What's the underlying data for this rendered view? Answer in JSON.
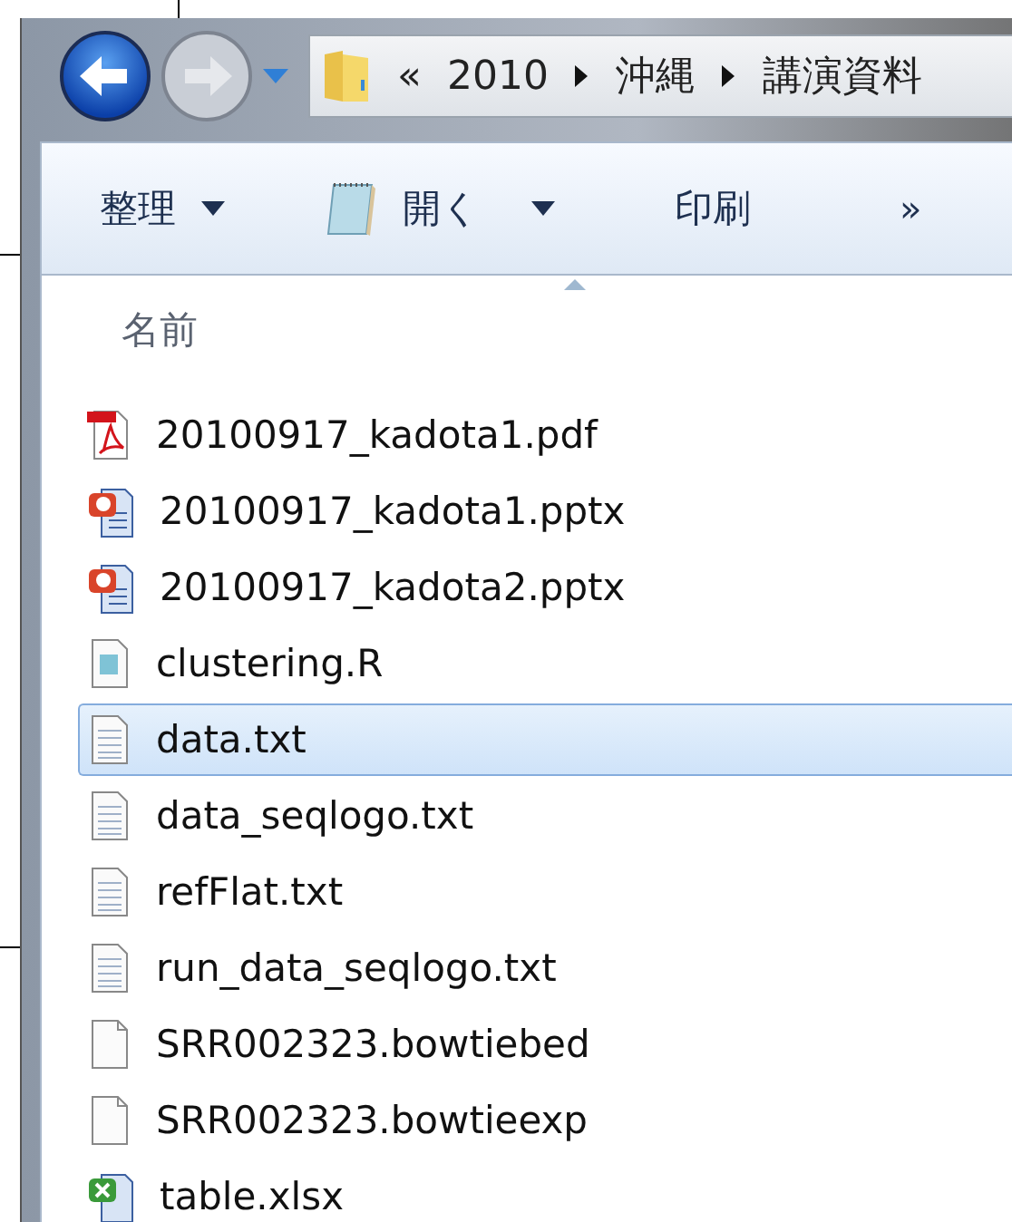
{
  "address_bar": {
    "overflow": "«",
    "path": [
      "2010",
      "沖縄",
      "講演資料"
    ]
  },
  "toolbar": [
    {
      "label": "整理",
      "kind": "menu"
    },
    {
      "label": "開く",
      "kind": "open"
    },
    {
      "label": "印刷",
      "kind": "plain"
    },
    {
      "label": "»",
      "kind": "more"
    }
  ],
  "column_header": "名前",
  "files": [
    {
      "name": "20100917_kadota1.pdf",
      "kind": "pdf",
      "selected": false
    },
    {
      "name": "20100917_kadota1.pptx",
      "kind": "pptx",
      "selected": false
    },
    {
      "name": "20100917_kadota2.pptx",
      "kind": "pptx",
      "selected": false
    },
    {
      "name": "clustering.R",
      "kind": "r",
      "selected": false
    },
    {
      "name": "data.txt",
      "kind": "txt",
      "selected": true
    },
    {
      "name": "data_seqlogo.txt",
      "kind": "txt",
      "selected": false
    },
    {
      "name": "refFlat.txt",
      "kind": "txt",
      "selected": false
    },
    {
      "name": "run_data_seqlogo.txt",
      "kind": "txt",
      "selected": false
    },
    {
      "name": "SRR002323.bowtiebed",
      "kind": "blank",
      "selected": false
    },
    {
      "name": "SRR002323.bowtieexp",
      "kind": "blank",
      "selected": false
    },
    {
      "name": "table.xlsx",
      "kind": "xlsx",
      "selected": false
    }
  ]
}
